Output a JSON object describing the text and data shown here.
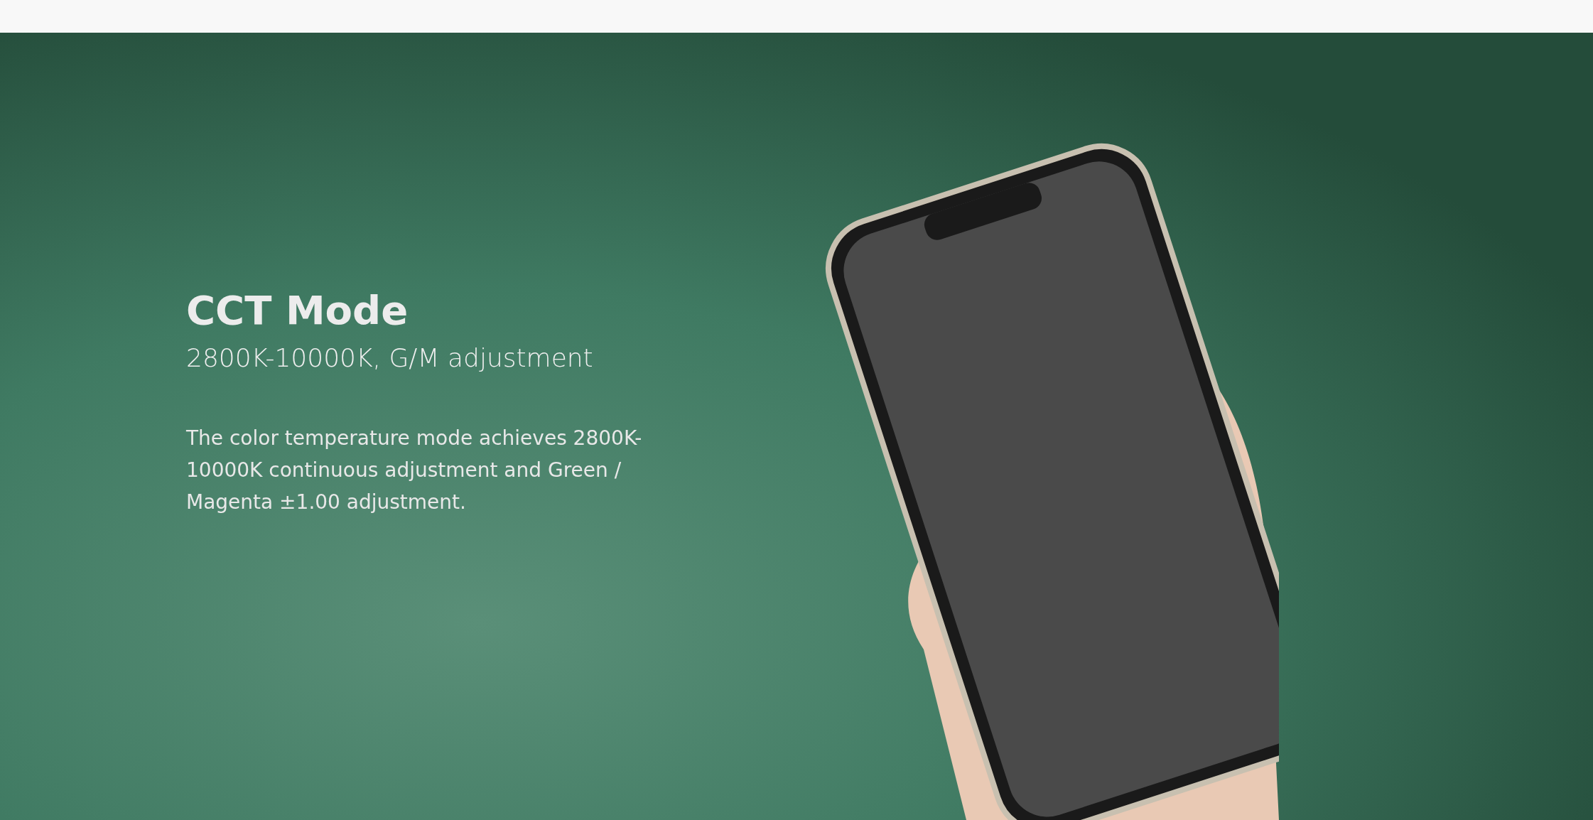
{
  "hero": {
    "title": "CCT Mode",
    "subtitle": "2800K-10000K, G/M adjustment",
    "description": "The color temperature mode achieves 2800K-10000K continuous adjustment and Green / Magenta ±1.00 adjustment."
  }
}
